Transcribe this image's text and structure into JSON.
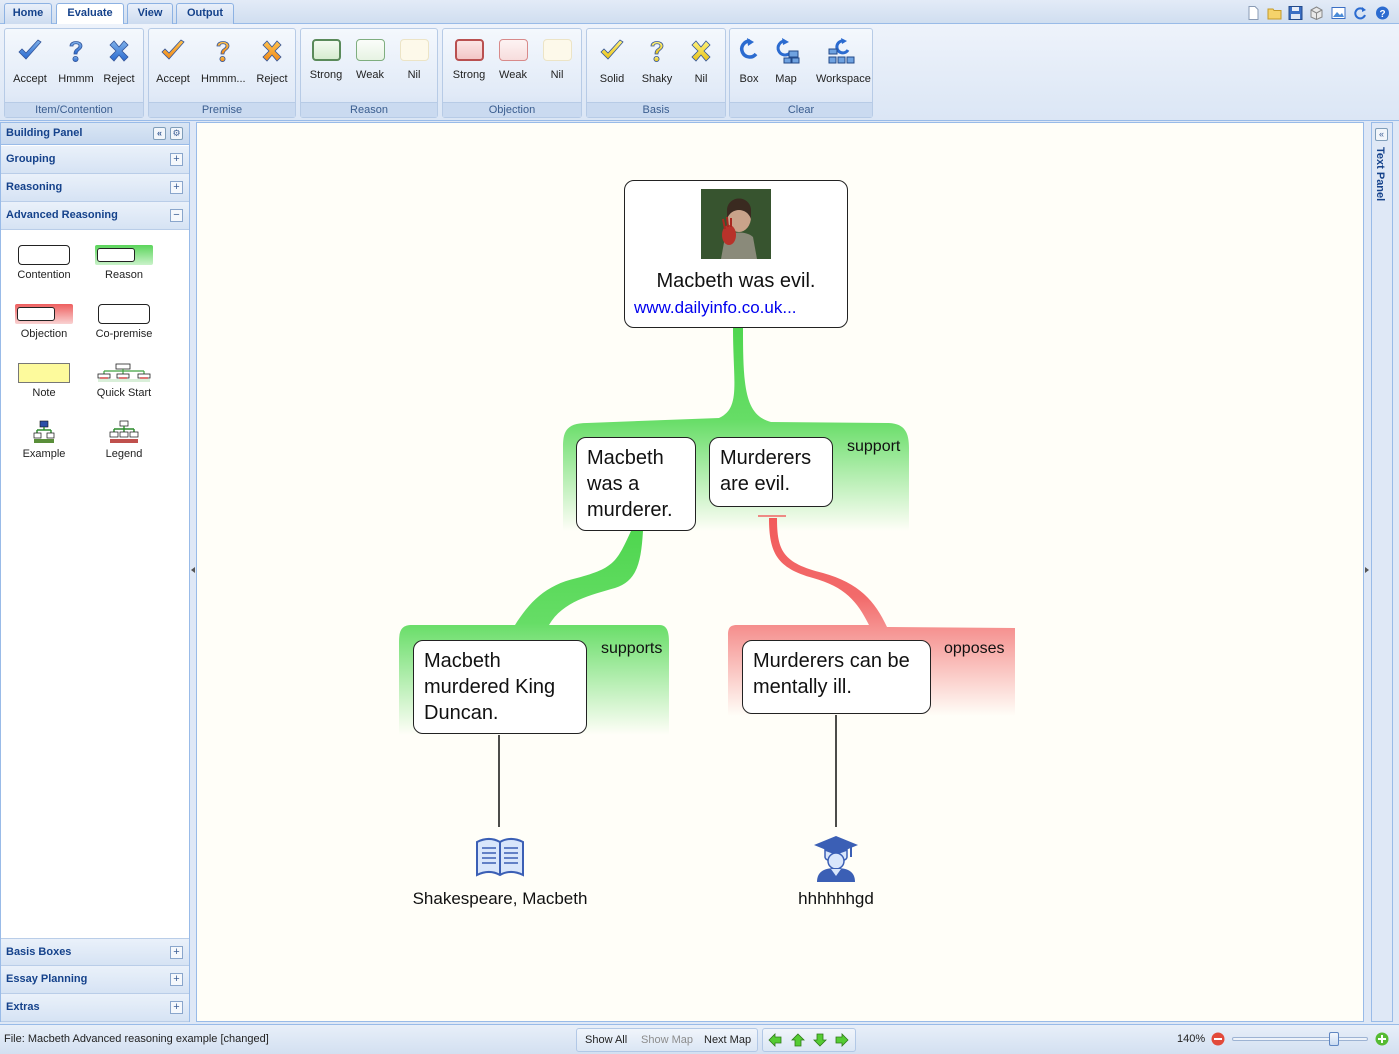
{
  "tabs": [
    {
      "label": "Home"
    },
    {
      "label": "Evaluate"
    },
    {
      "label": "View"
    },
    {
      "label": "Output"
    }
  ],
  "ribbon": {
    "groups": [
      {
        "title": "Item/Contention",
        "buttons": [
          {
            "label": "Accept",
            "icon": "check-icon"
          },
          {
            "label": "Hmmm",
            "icon": "question-icon"
          },
          {
            "label": "Reject",
            "icon": "cross-icon"
          }
        ]
      },
      {
        "title": "Premise",
        "buttons": [
          {
            "label": "Accept",
            "icon": "check-icon"
          },
          {
            "label": "Hmmm...",
            "icon": "question-icon"
          },
          {
            "label": "Reject",
            "icon": "cross-icon"
          }
        ]
      },
      {
        "title": "Reason",
        "buttons": [
          {
            "label": "Strong",
            "icon": "strong-swatch-icon"
          },
          {
            "label": "Weak",
            "icon": "weak-swatch-icon"
          },
          {
            "label": "Nil",
            "icon": "nil-swatch-icon"
          }
        ]
      },
      {
        "title": "Objection",
        "buttons": [
          {
            "label": "Strong",
            "icon": "strong-swatch-icon"
          },
          {
            "label": "Weak",
            "icon": "weak-swatch-icon"
          },
          {
            "label": "Nil",
            "icon": "nil-swatch-icon"
          }
        ]
      },
      {
        "title": "Basis",
        "buttons": [
          {
            "label": "Solid",
            "icon": "check-icon"
          },
          {
            "label": "Shaky",
            "icon": "question-icon"
          },
          {
            "label": "Nil",
            "icon": "cross-icon"
          }
        ]
      },
      {
        "title": "Clear",
        "buttons": [
          {
            "label": "Box",
            "icon": "clear-box-icon"
          },
          {
            "label": "Map",
            "icon": "clear-map-icon"
          },
          {
            "label": "Workspace",
            "icon": "clear-workspace-icon"
          }
        ]
      }
    ]
  },
  "building_panel": {
    "title": "Building Panel",
    "sections": [
      {
        "label": "Grouping",
        "expanded": false
      },
      {
        "label": "Reasoning",
        "expanded": false
      },
      {
        "label": "Advanced Reasoning",
        "expanded": true
      }
    ],
    "tools": [
      {
        "label": "Contention",
        "icon": "contention-box-icon"
      },
      {
        "label": "Reason",
        "icon": "reason-box-icon"
      },
      {
        "label": "Objection",
        "icon": "objection-box-icon"
      },
      {
        "label": "Co-premise",
        "icon": "co-premise-box-icon"
      },
      {
        "label": "Note",
        "icon": "note-icon"
      },
      {
        "label": "Quick Start",
        "icon": "quick-start-icon"
      },
      {
        "label": "Example",
        "icon": "example-icon"
      },
      {
        "label": "Legend",
        "icon": "legend-icon"
      }
    ],
    "bottom_sections": [
      {
        "label": "Basis Boxes"
      },
      {
        "label": "Essay Planning"
      },
      {
        "label": "Extras"
      }
    ]
  },
  "map": {
    "contention": {
      "text": "Macbeth was evil.",
      "link": "www.dailyinfo.co.uk..."
    },
    "reason": {
      "label": "support",
      "premises": [
        "Macbeth was a murderer.",
        "Murderers are evil."
      ]
    },
    "sub_reason": {
      "label": "supports",
      "text": "Macbeth murdered King Duncan."
    },
    "objection": {
      "label": "opposes",
      "text": "Murderers can be mentally ill."
    },
    "bases": [
      {
        "label": "Shakespeare, Macbeth",
        "icon": "book-icon"
      },
      {
        "label": "hhhhhhgd",
        "icon": "expert-graduate-icon"
      }
    ],
    "colors": {
      "support": "#55d555",
      "oppose": "#f06464"
    }
  },
  "text_panel": {
    "label": "Text Panel"
  },
  "status": {
    "file": "File: Macbeth Advanced reasoning example [changed]",
    "show_all": "Show All",
    "show_map": "Show Map",
    "next_map": "Next Map",
    "zoom": "140%",
    "zoom_level": 0.75
  }
}
